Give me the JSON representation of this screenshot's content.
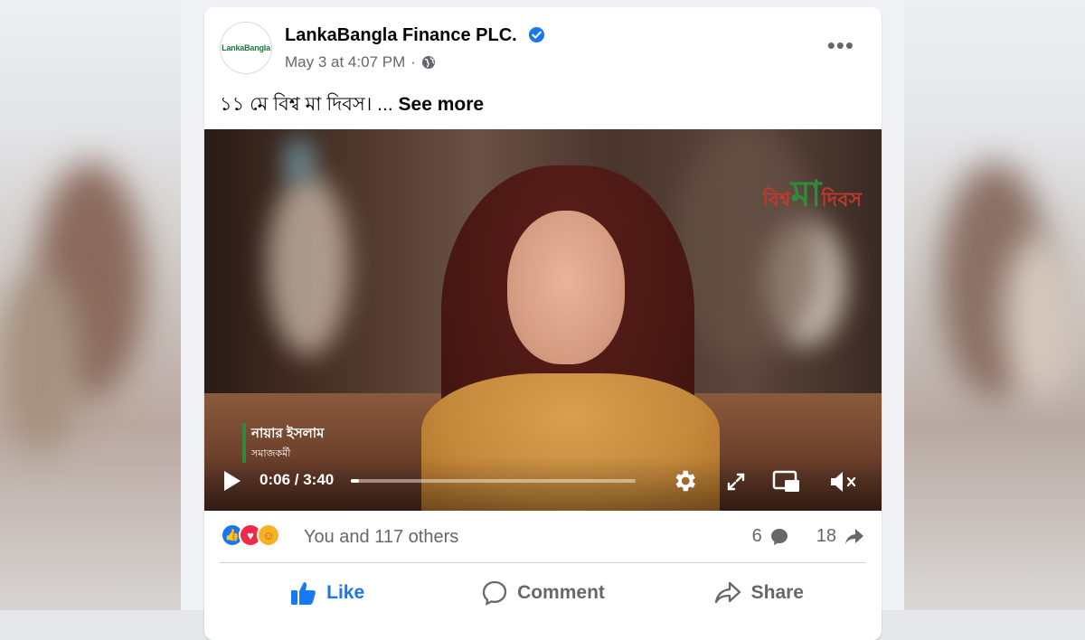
{
  "post": {
    "page_name": "LankaBangla Finance PLC.",
    "avatar_text": "LankaBangla",
    "timestamp": "May 3 at 4:07 PM",
    "separator": "·",
    "caption": "১১ মে বিশ্ব মা দিবস।",
    "ellipsis": "...",
    "see_more": "See more"
  },
  "video": {
    "overlay_logo": {
      "left": "বিশ্ব",
      "middle": "মা",
      "right": "দিবস"
    },
    "name_tag": {
      "name": "নায়ার ইসলাম",
      "role": "সমাজকর্মী"
    },
    "current_time": "0:06",
    "duration": "3:40",
    "progress_fraction": 0.03
  },
  "stats": {
    "reactions_text": "You and 117 others",
    "comments_count": "6",
    "shares_count": "18"
  },
  "actions": {
    "like": "Like",
    "comment": "Comment",
    "share": "Share"
  },
  "colors": {
    "accent": "#1877f2",
    "muted_text": "#65676b"
  }
}
